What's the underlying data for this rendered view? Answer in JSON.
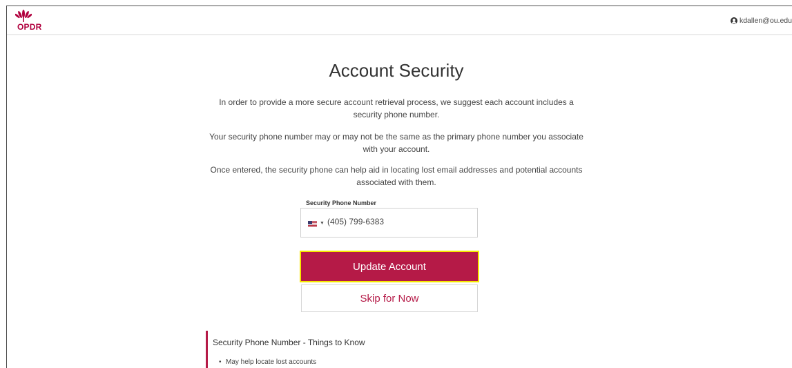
{
  "header": {
    "logo_text": "OPDR",
    "user_email": "kdallen@ou.edu"
  },
  "main": {
    "title": "Account Security",
    "paragraphs": [
      "In order to provide a more secure account retrieval process, we suggest each account includes a security phone number.",
      "Your security phone number may or may not be the same as the primary phone number you associate with your account.",
      "Once entered, the security phone can help aid in locating lost email addresses and potential accounts associated with them."
    ],
    "phone_field": {
      "label": "Security Phone Number",
      "value": "(405) 799-6383",
      "country_icon": "us-flag-icon"
    },
    "update_button": "Update Account",
    "skip_button": "Skip for Now"
  },
  "info": {
    "title": "Security Phone Number - Things to Know",
    "items": [
      "May help locate lost accounts"
    ]
  },
  "colors": {
    "brand": "#b51a47",
    "focus_outline": "#f5e800"
  }
}
